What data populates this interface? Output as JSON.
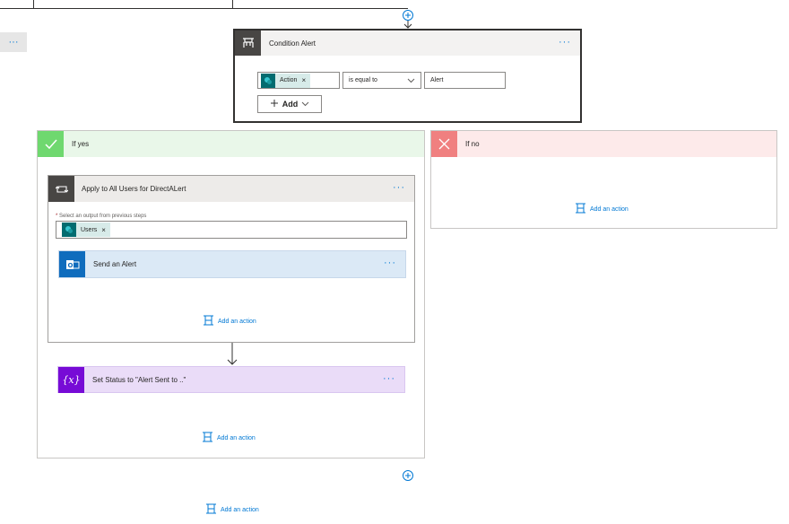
{
  "condition": {
    "title": "Condition Alert",
    "token": "Action",
    "token_remove": "×",
    "operator": "is equal to",
    "value": "Alert",
    "add_label": "Add"
  },
  "left_stub": {
    "more": "···"
  },
  "if_yes": {
    "title": "If yes"
  },
  "if_no": {
    "title": "If no",
    "add_action": "Add an action"
  },
  "apply": {
    "title": "Apply to All Users for DirectALert",
    "required_mark": "*",
    "field_label": "Select an output from previous steps",
    "token": "Users",
    "token_remove": "×",
    "add_action": "Add an action"
  },
  "send_alert": {
    "title": "Send an Alert"
  },
  "set_status": {
    "title": "Set Status to \"Alert Sent to ..\"",
    "icon_text": "{x}"
  },
  "yes_add_action": "Add an action",
  "bottom_add_action": "Add an action",
  "more": "···",
  "colors": {
    "condition_header": "#484644",
    "yes": "#6fd86f",
    "yes_bg": "#e9f7e9",
    "no": "#f08080",
    "no_bg": "#fdeaea",
    "loop_header": "#484644",
    "outlook": "#0f6cbd",
    "send_bg": "#dbe9f6",
    "variable": "#770bd6",
    "variable_bg": "#eadcf8",
    "link": "#0078d4"
  }
}
